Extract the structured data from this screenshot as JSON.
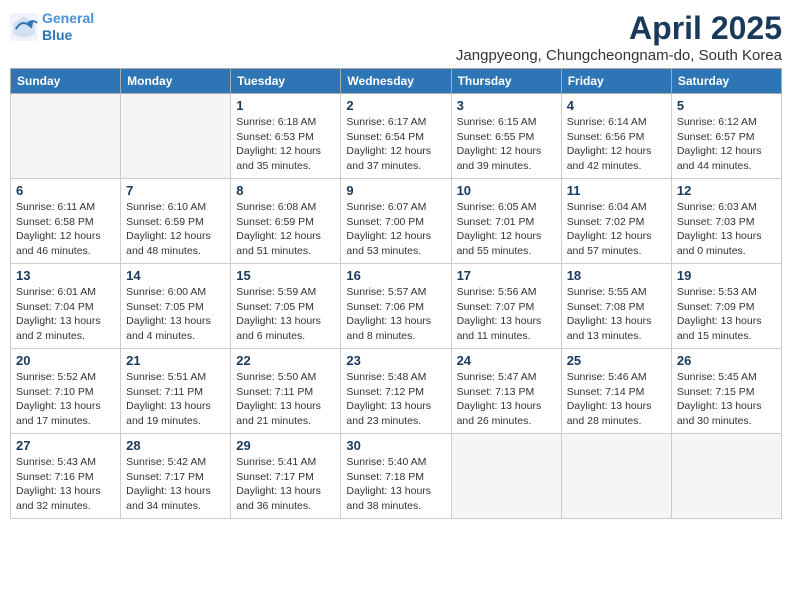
{
  "logo": {
    "line1": "General",
    "line2": "Blue"
  },
  "title": "April 2025",
  "location": "Jangpyeong, Chungcheongnam-do, South Korea",
  "weekdays": [
    "Sunday",
    "Monday",
    "Tuesday",
    "Wednesday",
    "Thursday",
    "Friday",
    "Saturday"
  ],
  "weeks": [
    [
      {
        "day": null,
        "info": null
      },
      {
        "day": null,
        "info": null
      },
      {
        "day": "1",
        "info": "Sunrise: 6:18 AM\nSunset: 6:53 PM\nDaylight: 12 hours\nand 35 minutes."
      },
      {
        "day": "2",
        "info": "Sunrise: 6:17 AM\nSunset: 6:54 PM\nDaylight: 12 hours\nand 37 minutes."
      },
      {
        "day": "3",
        "info": "Sunrise: 6:15 AM\nSunset: 6:55 PM\nDaylight: 12 hours\nand 39 minutes."
      },
      {
        "day": "4",
        "info": "Sunrise: 6:14 AM\nSunset: 6:56 PM\nDaylight: 12 hours\nand 42 minutes."
      },
      {
        "day": "5",
        "info": "Sunrise: 6:12 AM\nSunset: 6:57 PM\nDaylight: 12 hours\nand 44 minutes."
      }
    ],
    [
      {
        "day": "6",
        "info": "Sunrise: 6:11 AM\nSunset: 6:58 PM\nDaylight: 12 hours\nand 46 minutes."
      },
      {
        "day": "7",
        "info": "Sunrise: 6:10 AM\nSunset: 6:59 PM\nDaylight: 12 hours\nand 48 minutes."
      },
      {
        "day": "8",
        "info": "Sunrise: 6:08 AM\nSunset: 6:59 PM\nDaylight: 12 hours\nand 51 minutes."
      },
      {
        "day": "9",
        "info": "Sunrise: 6:07 AM\nSunset: 7:00 PM\nDaylight: 12 hours\nand 53 minutes."
      },
      {
        "day": "10",
        "info": "Sunrise: 6:05 AM\nSunset: 7:01 PM\nDaylight: 12 hours\nand 55 minutes."
      },
      {
        "day": "11",
        "info": "Sunrise: 6:04 AM\nSunset: 7:02 PM\nDaylight: 12 hours\nand 57 minutes."
      },
      {
        "day": "12",
        "info": "Sunrise: 6:03 AM\nSunset: 7:03 PM\nDaylight: 13 hours\nand 0 minutes."
      }
    ],
    [
      {
        "day": "13",
        "info": "Sunrise: 6:01 AM\nSunset: 7:04 PM\nDaylight: 13 hours\nand 2 minutes."
      },
      {
        "day": "14",
        "info": "Sunrise: 6:00 AM\nSunset: 7:05 PM\nDaylight: 13 hours\nand 4 minutes."
      },
      {
        "day": "15",
        "info": "Sunrise: 5:59 AM\nSunset: 7:05 PM\nDaylight: 13 hours\nand 6 minutes."
      },
      {
        "day": "16",
        "info": "Sunrise: 5:57 AM\nSunset: 7:06 PM\nDaylight: 13 hours\nand 8 minutes."
      },
      {
        "day": "17",
        "info": "Sunrise: 5:56 AM\nSunset: 7:07 PM\nDaylight: 13 hours\nand 11 minutes."
      },
      {
        "day": "18",
        "info": "Sunrise: 5:55 AM\nSunset: 7:08 PM\nDaylight: 13 hours\nand 13 minutes."
      },
      {
        "day": "19",
        "info": "Sunrise: 5:53 AM\nSunset: 7:09 PM\nDaylight: 13 hours\nand 15 minutes."
      }
    ],
    [
      {
        "day": "20",
        "info": "Sunrise: 5:52 AM\nSunset: 7:10 PM\nDaylight: 13 hours\nand 17 minutes."
      },
      {
        "day": "21",
        "info": "Sunrise: 5:51 AM\nSunset: 7:11 PM\nDaylight: 13 hours\nand 19 minutes."
      },
      {
        "day": "22",
        "info": "Sunrise: 5:50 AM\nSunset: 7:11 PM\nDaylight: 13 hours\nand 21 minutes."
      },
      {
        "day": "23",
        "info": "Sunrise: 5:48 AM\nSunset: 7:12 PM\nDaylight: 13 hours\nand 23 minutes."
      },
      {
        "day": "24",
        "info": "Sunrise: 5:47 AM\nSunset: 7:13 PM\nDaylight: 13 hours\nand 26 minutes."
      },
      {
        "day": "25",
        "info": "Sunrise: 5:46 AM\nSunset: 7:14 PM\nDaylight: 13 hours\nand 28 minutes."
      },
      {
        "day": "26",
        "info": "Sunrise: 5:45 AM\nSunset: 7:15 PM\nDaylight: 13 hours\nand 30 minutes."
      }
    ],
    [
      {
        "day": "27",
        "info": "Sunrise: 5:43 AM\nSunset: 7:16 PM\nDaylight: 13 hours\nand 32 minutes."
      },
      {
        "day": "28",
        "info": "Sunrise: 5:42 AM\nSunset: 7:17 PM\nDaylight: 13 hours\nand 34 minutes."
      },
      {
        "day": "29",
        "info": "Sunrise: 5:41 AM\nSunset: 7:17 PM\nDaylight: 13 hours\nand 36 minutes."
      },
      {
        "day": "30",
        "info": "Sunrise: 5:40 AM\nSunset: 7:18 PM\nDaylight: 13 hours\nand 38 minutes."
      },
      {
        "day": null,
        "info": null
      },
      {
        "day": null,
        "info": null
      },
      {
        "day": null,
        "info": null
      }
    ]
  ]
}
